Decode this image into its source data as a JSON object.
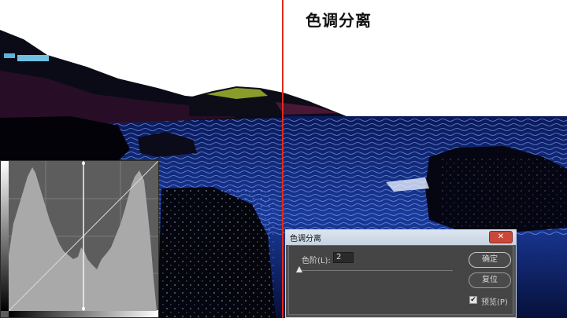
{
  "heading": "色调分离",
  "dialog": {
    "title": "色调分离",
    "close_icon": "close-icon",
    "levels_label": "色阶(L):",
    "levels_value": "2",
    "ok_label": "确定",
    "reset_label": "复位",
    "preview_label": "预览(P)",
    "preview_checked": true
  },
  "colors": {
    "divider": "#e02a1a",
    "dialog_bg": "#535353",
    "titlebar": "#c6d3e0",
    "close": "#c9483a"
  }
}
